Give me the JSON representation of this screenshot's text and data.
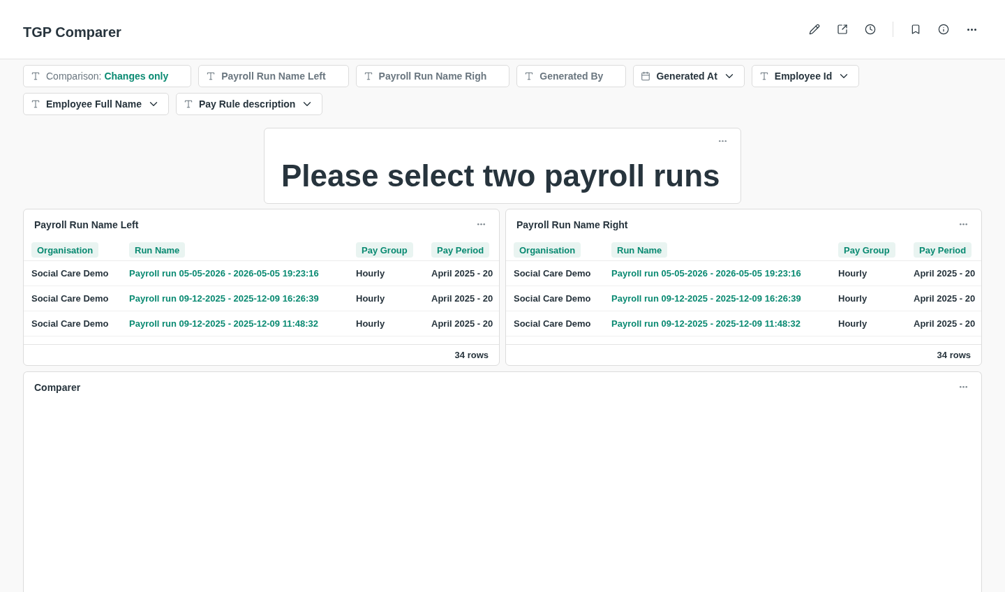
{
  "header": {
    "title": "TGP Comparer"
  },
  "filters": [
    {
      "kind": "text",
      "label": "Comparison:",
      "value": "Changes only",
      "dropdown": false
    },
    {
      "kind": "text",
      "label": "Payroll Run Name Left",
      "dropdown": false
    },
    {
      "kind": "text",
      "label": "Payroll Run Name Righ",
      "dropdown": false
    },
    {
      "kind": "text",
      "label": "Generated By",
      "dropdown": false
    },
    {
      "kind": "date",
      "label": "Generated At",
      "dropdown": true
    },
    {
      "kind": "text",
      "label": "Employee Id",
      "dropdown": true
    },
    {
      "kind": "text",
      "label": "Employee Full Name",
      "dropdown": true
    },
    {
      "kind": "text",
      "label": "Pay Rule description",
      "dropdown": true
    }
  ],
  "notice": {
    "text": "Please select two payroll runs"
  },
  "tables": [
    {
      "title": "Payroll Run Name Left",
      "columns": [
        {
          "label": "Organisation",
          "kind": "text"
        },
        {
          "label": "Run Name",
          "kind": "link"
        },
        {
          "label": "Pay Group",
          "kind": "text"
        },
        {
          "label": "Pay Period",
          "kind": "text"
        }
      ],
      "rows": [
        [
          "Social Care Demo",
          "Payroll run 05-05-2026 - 2026-05-05 19:23:16",
          "Hourly",
          "April 2025 - 20"
        ],
        [
          "Social Care Demo",
          "Payroll run 09-12-2025 - 2025-12-09 16:26:39",
          "Hourly",
          "April 2025 - 20"
        ],
        [
          "Social Care Demo",
          "Payroll run 09-12-2025 - 2025-12-09 11:48:32",
          "Hourly",
          "April 2025 - 20"
        ]
      ],
      "footer": "34 rows"
    },
    {
      "title": "Payroll Run Name Right",
      "columns": [
        {
          "label": "Organisation",
          "kind": "text"
        },
        {
          "label": "Run Name",
          "kind": "link"
        },
        {
          "label": "Pay Group",
          "kind": "text"
        },
        {
          "label": "Pay Period",
          "kind": "text"
        }
      ],
      "rows": [
        [
          "Social Care Demo",
          "Payroll run 05-05-2026 - 2026-05-05 19:23:16",
          "Hourly",
          "April 2025 - 20"
        ],
        [
          "Social Care Demo",
          "Payroll run 09-12-2025 - 2025-12-09 16:26:39",
          "Hourly",
          "April 2025 - 20"
        ],
        [
          "Social Care Demo",
          "Payroll run 09-12-2025 - 2025-12-09 11:48:32",
          "Hourly",
          "April 2025 - 20"
        ]
      ],
      "footer": "34 rows"
    }
  ],
  "comparer": {
    "title": "Comparer"
  }
}
